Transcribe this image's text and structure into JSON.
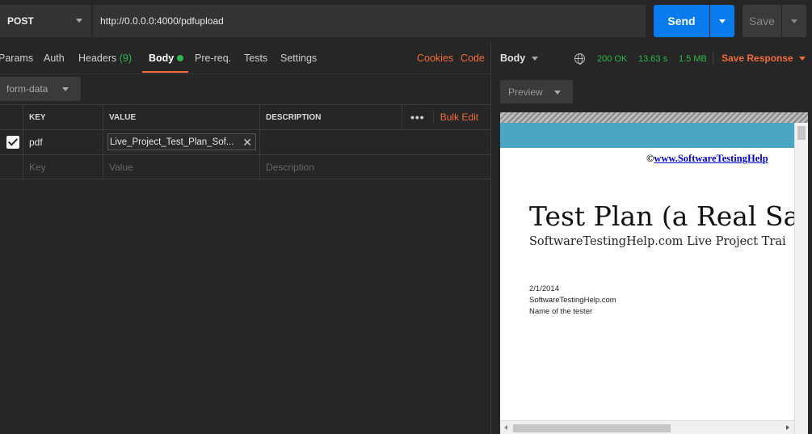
{
  "request": {
    "method": "POST",
    "url": "http://0.0.0.0:4000/pdfupload",
    "send_label": "Send",
    "save_label": "Save"
  },
  "tabs": {
    "params": "Params",
    "auth": "Auth",
    "headers": "Headers",
    "headers_count": "(9)",
    "body": "Body",
    "prereq": "Pre-req.",
    "tests": "Tests",
    "settings": "Settings",
    "cookies": "Cookies",
    "code": "Code"
  },
  "body_mode": "form-data",
  "params_table": {
    "headers": {
      "key": "KEY",
      "value": "VALUE",
      "description": "DESCRIPTION"
    },
    "more": "•••",
    "bulk_edit": "Bulk Edit",
    "rows": [
      {
        "checked": true,
        "key": "pdf",
        "value": "Live_Project_Test_Plan_Sof..."
      }
    ],
    "placeholder": {
      "key": "Key",
      "value": "Value",
      "description": "Description"
    }
  },
  "response": {
    "body_label": "Body",
    "status": "200 OK",
    "time": "13.63 s",
    "size": "1.5 MB",
    "save_response": "Save Response",
    "view_mode": "Preview"
  },
  "pdf": {
    "copyright_symbol": "©",
    "copyright_link": "www.SoftwareTestingHelp",
    "title": "Test Plan (a Real Sam",
    "subtitle": "SoftwareTestingHelp.com Live Project Trai",
    "date": "2/1/2014",
    "site": "SoftwareTestingHelp.com",
    "tester": "Name of the tester"
  },
  "colors": {
    "accent_orange": "#f26b3a",
    "send_blue": "#097bed",
    "status_green": "#2eb84b",
    "pdf_band": "#4aa6c2"
  }
}
